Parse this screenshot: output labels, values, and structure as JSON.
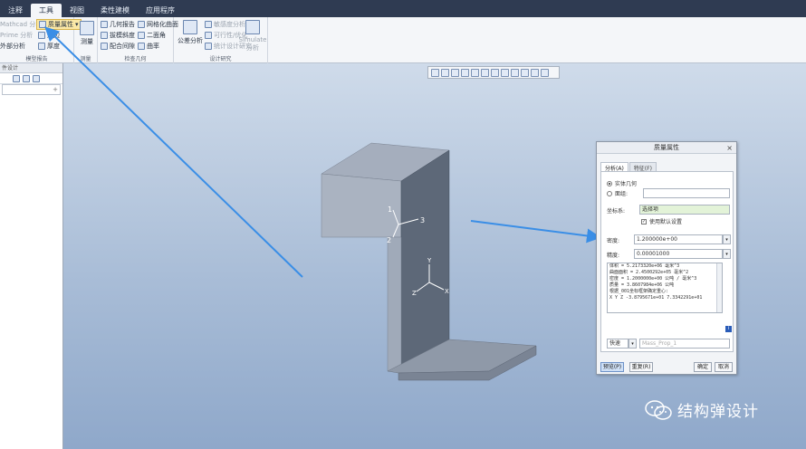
{
  "menu_tabs": [
    "注释",
    "工具",
    "视图",
    "柔性建模",
    "应用程序"
  ],
  "ribbon": {
    "model_report": {
      "items": [
        "Mathcad 分析",
        "Prime 分析",
        "外部分析",
        "质量属性",
        "短边",
        "厚度"
      ],
      "group_label": "模型报告"
    },
    "measure": {
      "label": "测量",
      "group_label": "测量"
    },
    "inspect_geometry": {
      "items": [
        "几何报告",
        "拔模斜度",
        "配合间隙",
        "网格化曲面",
        "二面角",
        "曲率"
      ],
      "group_label": "检查几何"
    },
    "design_study": {
      "items": [
        "公差分析",
        "敏感度分析",
        "可行性/优化",
        "统计设计研究",
        "Simulate 分析"
      ],
      "group_label": "设计研究"
    }
  },
  "left_panel": {
    "header": "件设计",
    "search_icon": "+"
  },
  "dialog": {
    "title": "质量属性",
    "tabs": [
      "分析(A)",
      "特征(F)"
    ],
    "radio_solid": "实体几何",
    "radio_quilt": "面组:",
    "coord_label": "坐标系:",
    "coord_value": "选择项",
    "use_default": "使用默认设置",
    "density_label": "密度:",
    "density_value": "1.200000e+00",
    "accuracy_label": "精度:",
    "accuracy_value": "0.00001000",
    "results": [
      "体积 =  5.2173320e+06 毫米^3",
      "曲面面积 =  2.4500292e+05 毫米^2",
      "密度 =  1.2000000e+00 公吨 / 毫米^3",
      "质量 =  3.8607984e+06 公吨",
      "",
      "根据_001坐标框架确定重心:",
      "X  Y  Z   -3.8795671e+01  7.3342291e+01"
    ],
    "quick_label": "快速",
    "name_placeholder": "Mass_Prop_1",
    "buttons": {
      "preview": "预览(P)",
      "repeat": "重复(R)",
      "ok": "确定",
      "cancel": "取消"
    }
  },
  "axis_labels": {
    "y": "Y",
    "z": "Z",
    "x": "X",
    "n1": "1",
    "n2": "2",
    "n3": "3"
  },
  "watermark": "结构弹设计",
  "colors": {
    "accent_arrow": "#3a8ee6",
    "model_dark": "#5d6878",
    "model_light": "#a5aebd"
  }
}
